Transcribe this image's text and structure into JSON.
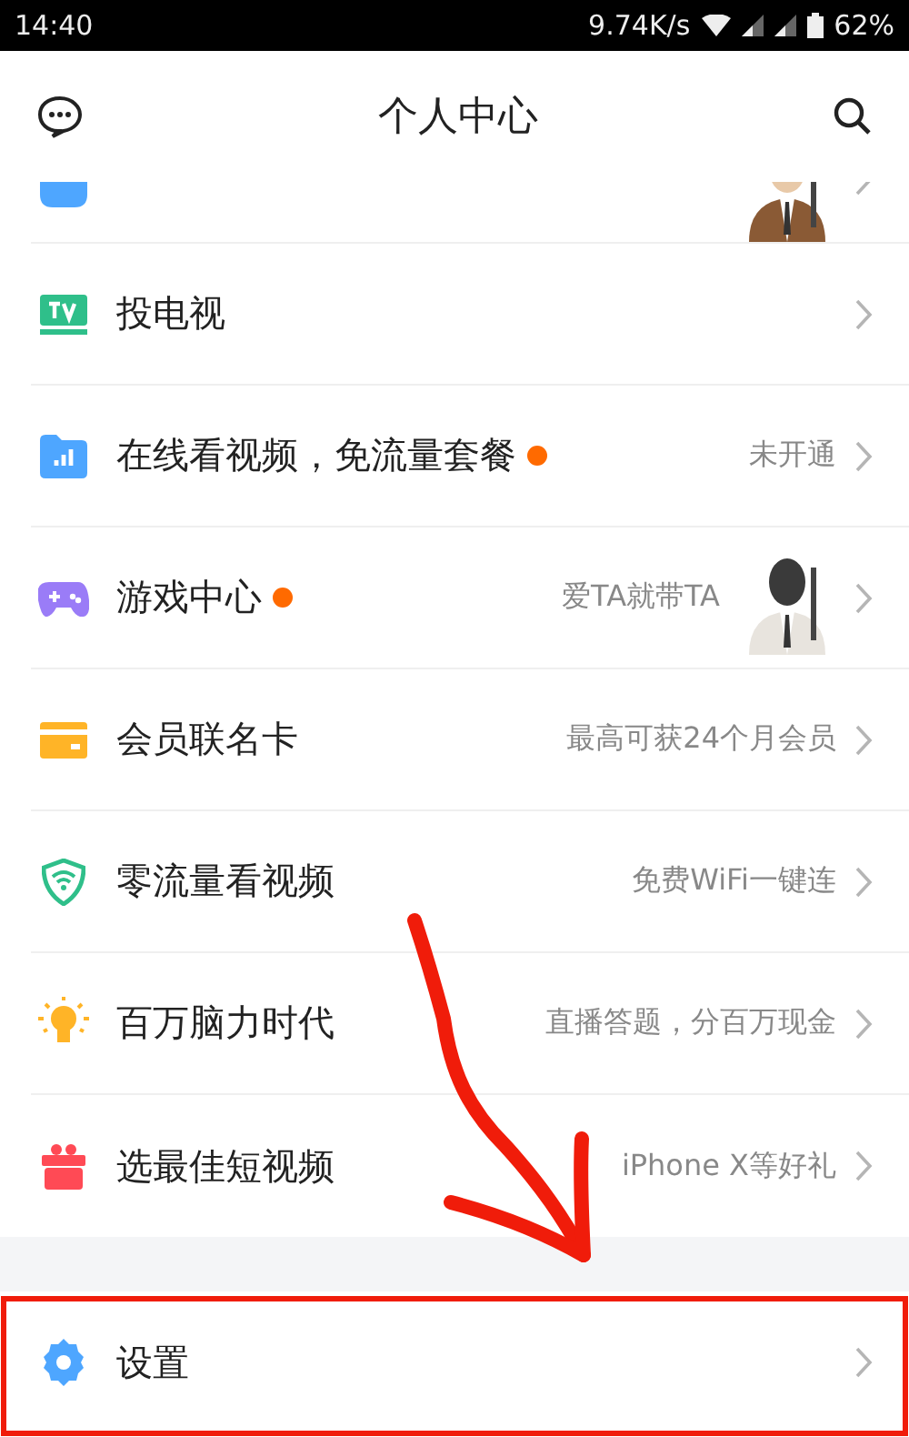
{
  "status_bar": {
    "time": "14:40",
    "network_speed": "9.74K/s",
    "battery": "62%"
  },
  "header": {
    "title": "个人中心"
  },
  "menu": [
    {
      "kind": "partial"
    },
    {
      "kind": "plain",
      "label": "投电视",
      "new": false
    },
    {
      "kind": "plain",
      "label": "在线看视频，免流量套餐",
      "note": "未开通",
      "new": true
    },
    {
      "kind": "picture",
      "label": "游戏中心",
      "note": "爱TA就带TA",
      "new": true
    },
    {
      "kind": "plain",
      "label": "会员联名卡",
      "note": "最高可获24个月会员",
      "new": false
    },
    {
      "kind": "plain",
      "label": "零流量看视频",
      "note": "免费WiFi一键连",
      "new": false
    },
    {
      "kind": "plain",
      "label": "百万脑力时代",
      "note": "直播答题，分百万现金",
      "new": false
    },
    {
      "kind": "plain",
      "label": "选最佳短视频",
      "note": "iPhone X等好礼",
      "new": false
    }
  ],
  "settings": {
    "label": "设置"
  }
}
